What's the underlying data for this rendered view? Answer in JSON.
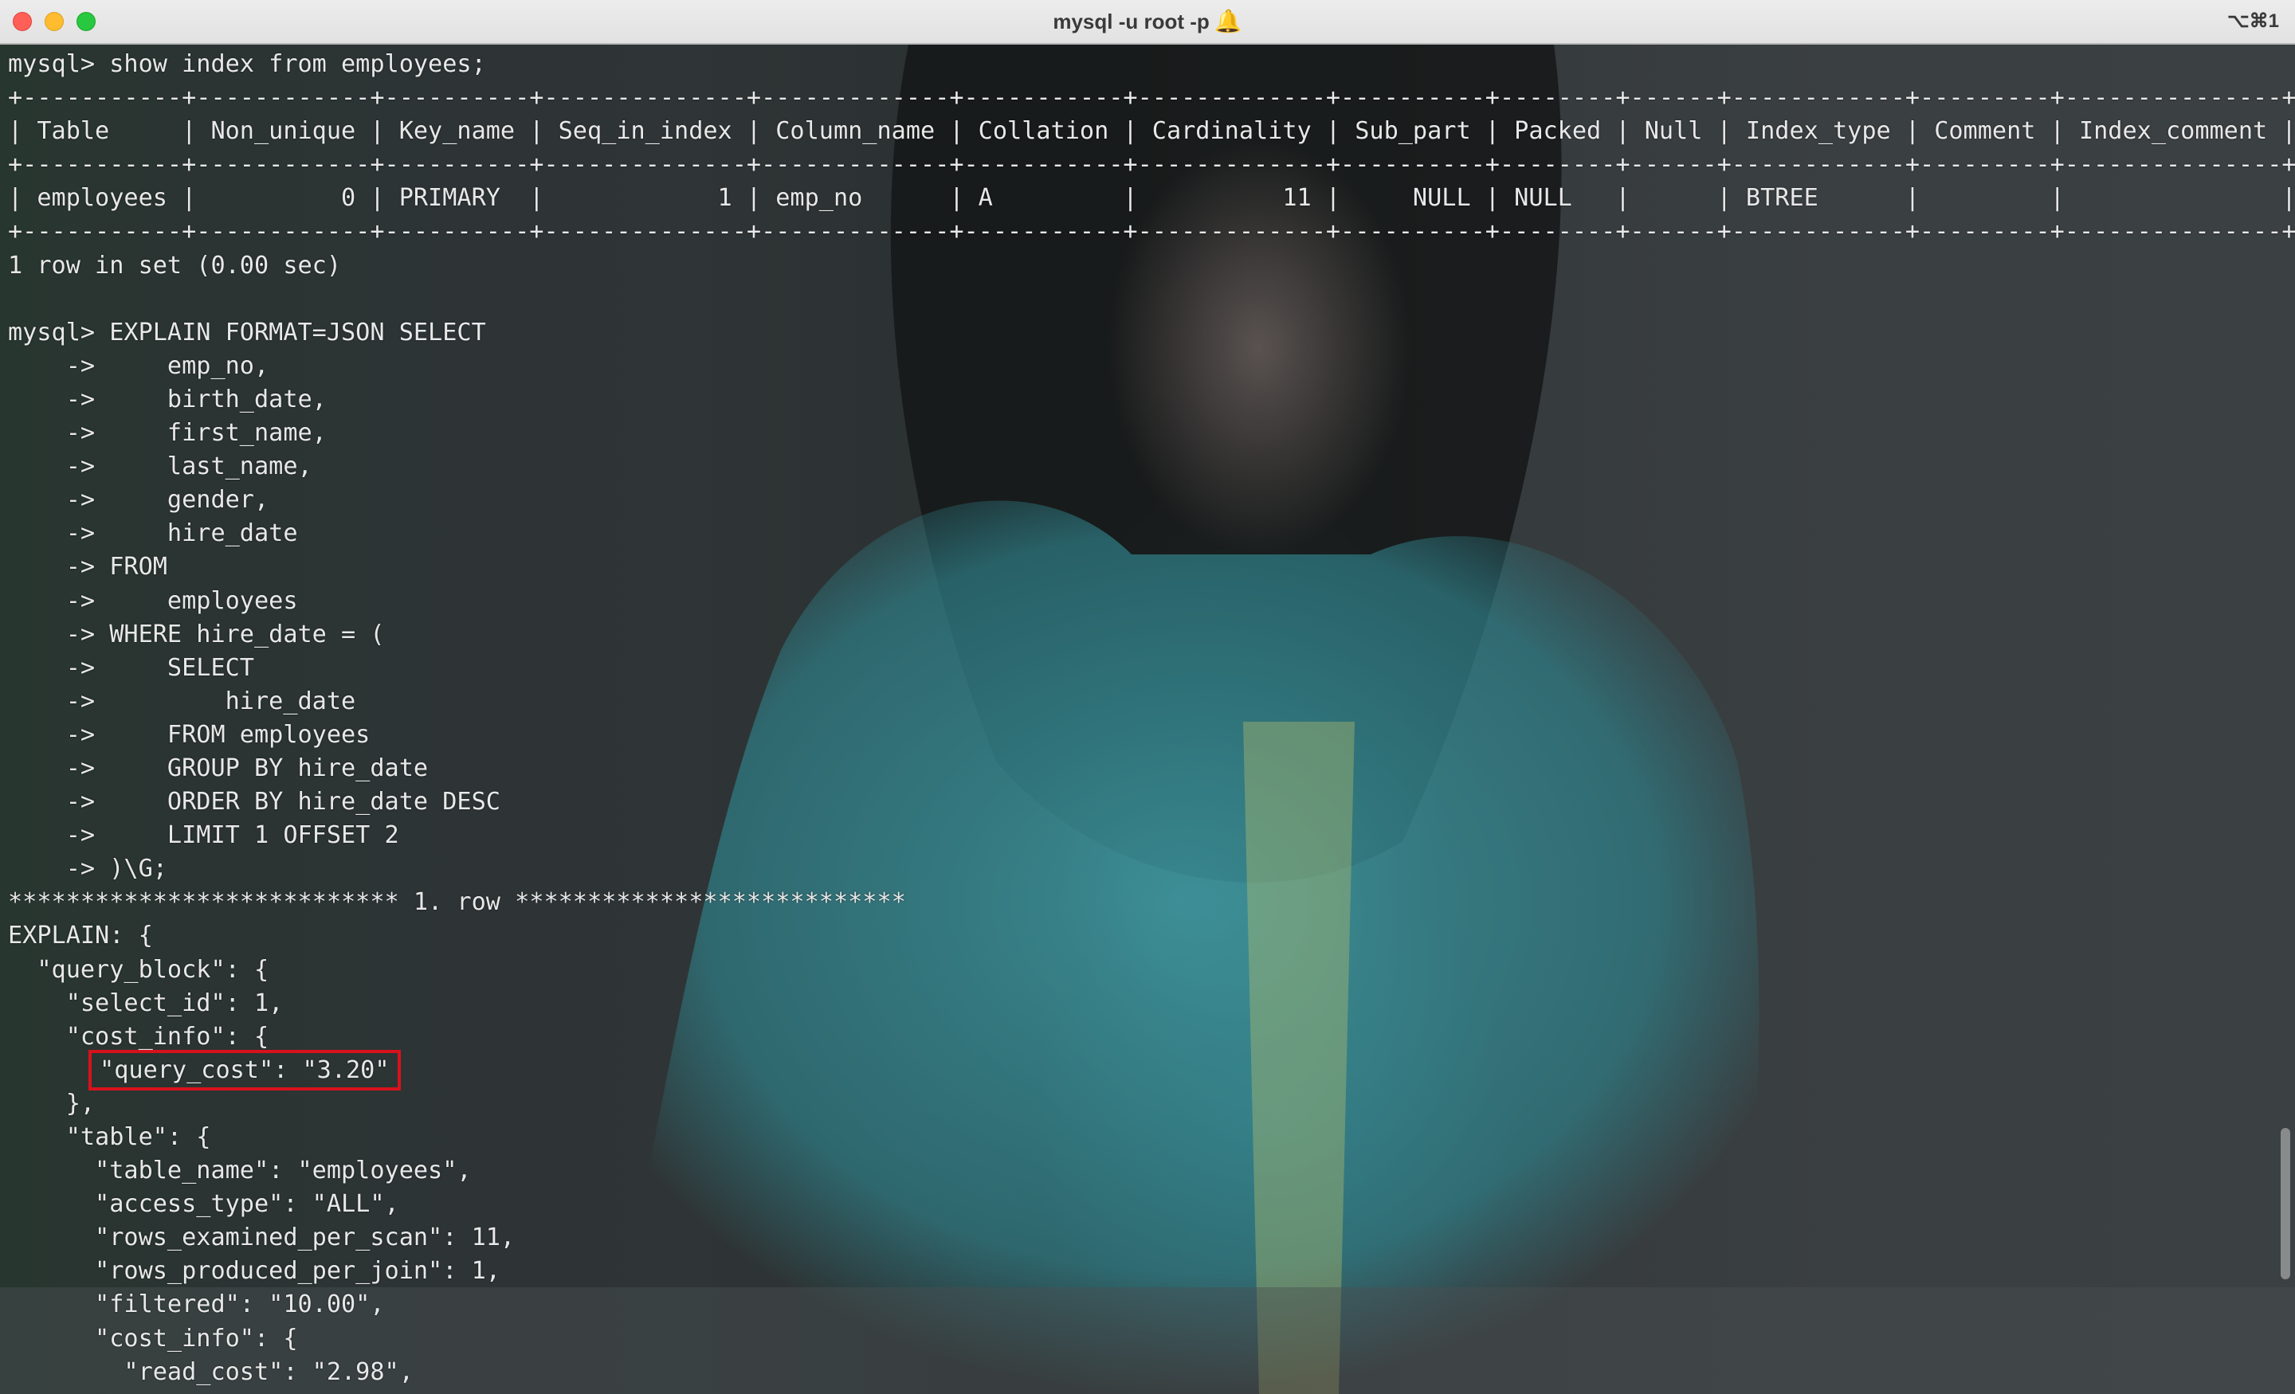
{
  "window": {
    "title": "mysql -u root -p",
    "title_icon": "bell-icon",
    "shortcut": "⌥⌘1"
  },
  "terminal": {
    "lines": [
      "mysql> show index from employees;",
      "+-----------+------------+----------+--------------+-------------+-----------+-------------+----------+--------+------+------------+---------+---------------+",
      "| Table     | Non_unique | Key_name | Seq_in_index | Column_name | Collation | Cardinality | Sub_part | Packed | Null | Index_type | Comment | Index_comment |",
      "+-----------+------------+----------+--------------+-------------+-----------+-------------+----------+--------+------+------------+---------+---------------+",
      "| employees |          0 | PRIMARY  |            1 | emp_no      | A         |          11 |     NULL | NULL   |      | BTREE      |         |               |",
      "+-----------+------------+----------+--------------+-------------+-----------+-------------+----------+--------+------+------------+---------+---------------+",
      "1 row in set (0.00 sec)",
      "",
      "mysql> EXPLAIN FORMAT=JSON SELECT",
      "    ->     emp_no,",
      "    ->     birth_date,",
      "    ->     first_name,",
      "    ->     last_name,",
      "    ->     gender,",
      "    ->     hire_date",
      "    -> FROM",
      "    ->     employees",
      "    -> WHERE hire_date = (",
      "    ->     SELECT",
      "    ->         hire_date",
      "    ->     FROM employees",
      "    ->     GROUP BY hire_date",
      "    ->     ORDER BY hire_date DESC",
      "    ->     LIMIT 1 OFFSET 2",
      "    -> )\\G;",
      "*************************** 1. row ***************************",
      "EXPLAIN: {",
      "  \"query_block\": {",
      "    \"select_id\": 1,",
      "    \"cost_info\": {",
      "      \"query_cost\": \"3.20\"",
      "    },",
      "    \"table\": {",
      "      \"table_name\": \"employees\",",
      "      \"access_type\": \"ALL\",",
      "      \"rows_examined_per_scan\": 11,",
      "      \"rows_produced_per_join\": 1,",
      "      \"filtered\": \"10.00\",",
      "      \"cost_info\": {",
      "        \"read_cost\": \"2.98\","
    ],
    "highlighted_line_index": 30,
    "highlight_color": "#d8121c",
    "text_color": "#e8e8e8"
  }
}
